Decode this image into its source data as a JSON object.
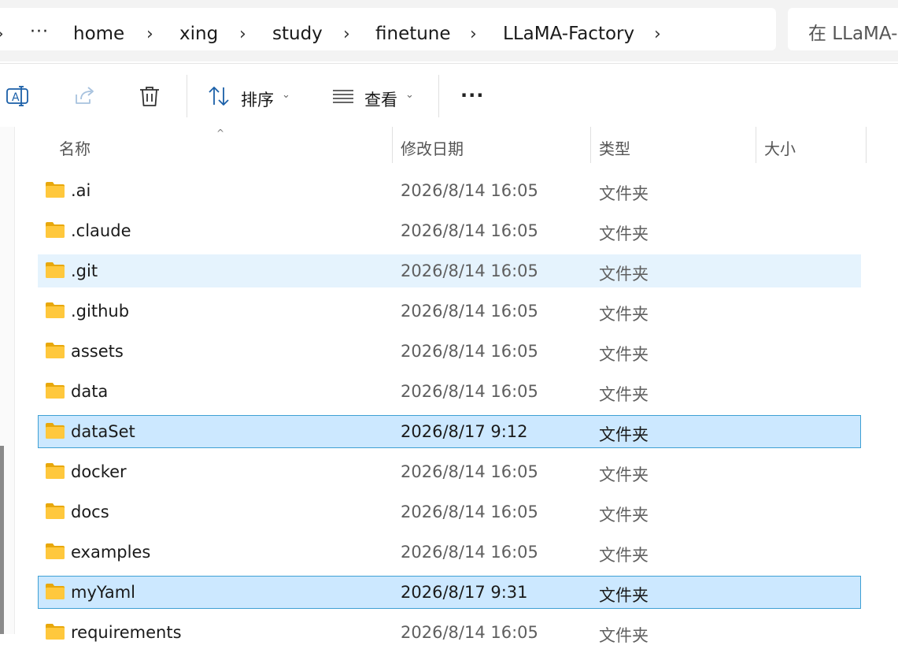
{
  "breadcrumb": {
    "overflow": "···",
    "items": [
      "home",
      "xing",
      "study",
      "finetune",
      "LLaMA-Factory"
    ],
    "separator": "›"
  },
  "search": {
    "placeholder": "在 LLaMA-Factory 中搜索"
  },
  "toolbar": {
    "sort_label": "排序",
    "view_label": "查看",
    "more_label": "···"
  },
  "columns": {
    "name": "名称",
    "modified": "修改日期",
    "type": "类型",
    "size": "大小"
  },
  "files": [
    {
      "name": ".ai",
      "modified": "2026/8/14 16:05",
      "type": "文件夹",
      "state": "normal"
    },
    {
      "name": ".claude",
      "modified": "2026/8/14 16:05",
      "type": "文件夹",
      "state": "normal"
    },
    {
      "name": ".git",
      "modified": "2026/8/14 16:05",
      "type": "文件夹",
      "state": "hover"
    },
    {
      "name": ".github",
      "modified": "2026/8/14 16:05",
      "type": "文件夹",
      "state": "normal"
    },
    {
      "name": "assets",
      "modified": "2026/8/14 16:05",
      "type": "文件夹",
      "state": "normal"
    },
    {
      "name": "data",
      "modified": "2026/8/14 16:05",
      "type": "文件夹",
      "state": "normal"
    },
    {
      "name": "dataSet",
      "modified": "2026/8/17 9:12",
      "type": "文件夹",
      "state": "selected"
    },
    {
      "name": "docker",
      "modified": "2026/8/14 16:05",
      "type": "文件夹",
      "state": "normal"
    },
    {
      "name": "docs",
      "modified": "2026/8/14 16:05",
      "type": "文件夹",
      "state": "normal"
    },
    {
      "name": "examples",
      "modified": "2026/8/14 16:05",
      "type": "文件夹",
      "state": "normal"
    },
    {
      "name": "myYaml",
      "modified": "2026/8/17 9:31",
      "type": "文件夹",
      "state": "selected"
    },
    {
      "name": "requirements",
      "modified": "2026/8/14 16:05",
      "type": "文件夹",
      "state": "normal"
    }
  ],
  "colors": {
    "selected_bg": "#cce8ff",
    "selected_border": "#3fa0d4",
    "hover_bg": "#e5f3fd",
    "folder_yellow": "#ffc83d"
  }
}
